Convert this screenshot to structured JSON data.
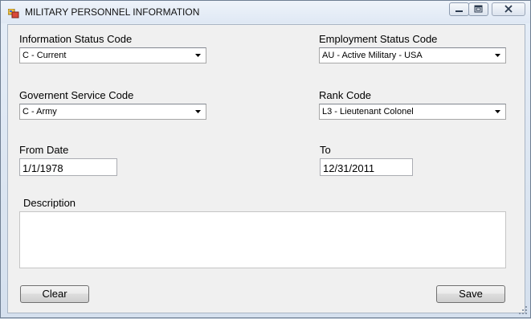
{
  "window": {
    "title": "MILITARY PERSONNEL INFORMATION",
    "controls": {
      "minimize_icon": "minimize-icon",
      "maximize_icon": "maximize-icon",
      "close_icon": "close-icon"
    }
  },
  "form": {
    "information_status": {
      "label": "Information Status Code",
      "value": "C - Current"
    },
    "employment_status": {
      "label": "Employment Status Code",
      "value": "AU - Active Military - USA"
    },
    "government_service": {
      "label": "Governent Service Code",
      "value": "C - Army"
    },
    "rank": {
      "label": "Rank Code",
      "value": "L3 - Lieutenant Colonel"
    },
    "from_date": {
      "label": "From Date",
      "value": "1/1/1978"
    },
    "to_date": {
      "label": "To",
      "value": "12/31/2011"
    },
    "description": {
      "label": "Description",
      "value": ""
    }
  },
  "buttons": {
    "clear": "Clear",
    "save": "Save"
  },
  "colors": {
    "window_frame": "#dbe5f1",
    "client_bg": "#f0f0f0",
    "close_hover": "#c75050"
  }
}
